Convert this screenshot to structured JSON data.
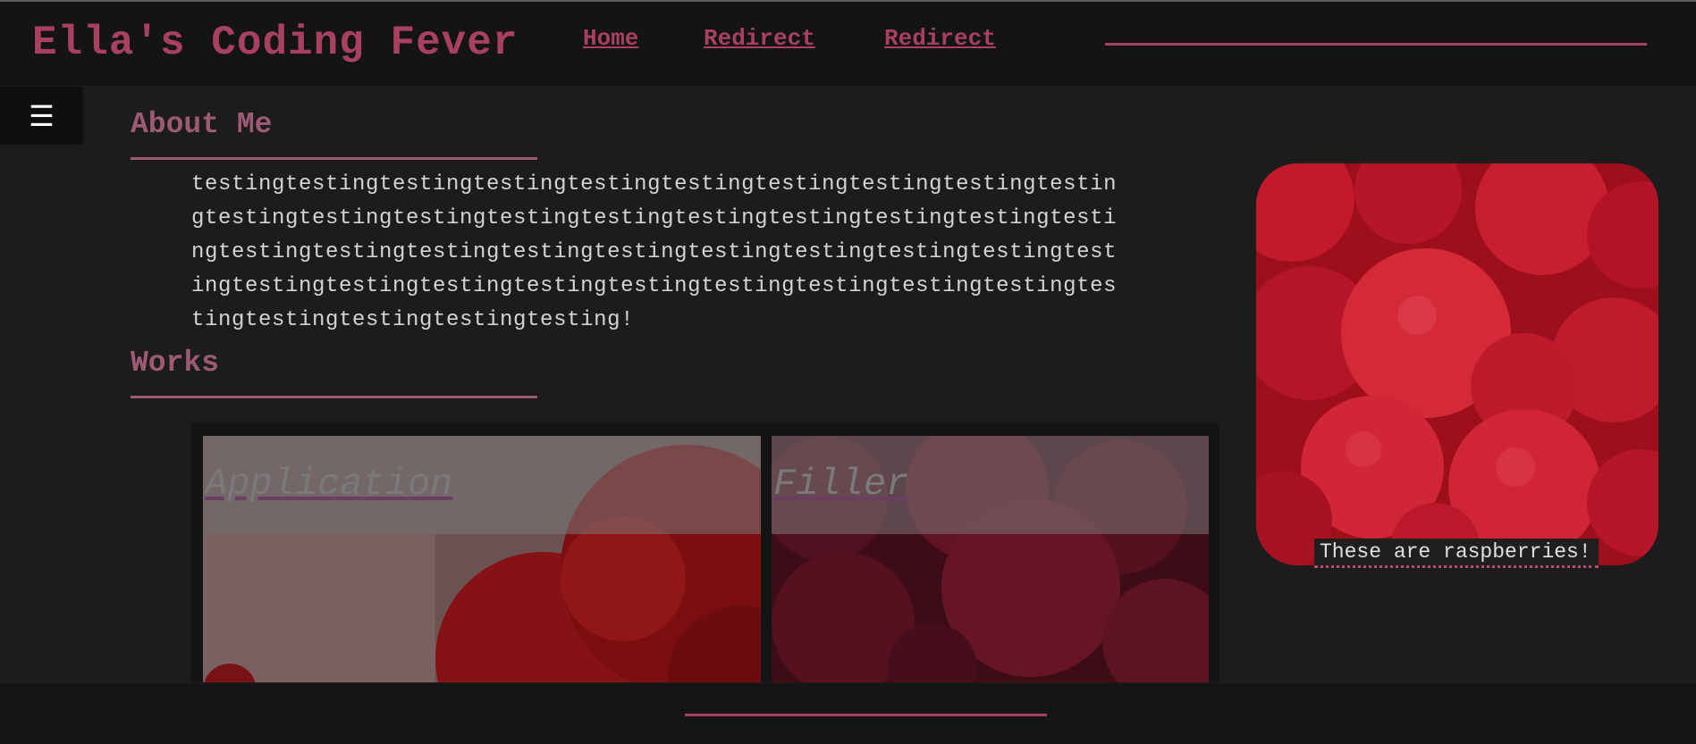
{
  "header": {
    "title": "Ella's Coding Fever",
    "nav": [
      {
        "label": "Home"
      },
      {
        "label": "Redirect"
      },
      {
        "label": "Redirect"
      }
    ]
  },
  "menu": {
    "icon": "hamburger-menu-icon",
    "glyph": "☰"
  },
  "about": {
    "heading": "About Me",
    "text": "testingtestingtestingtestingtestingtestingtestingtestingtestingtestingtestingtestingtestingtestingtestingtestingtestingtestingtestingtestingtestingtestingtestingtestingtestingtestingtestingtestingtestingtestingtestingtestingtestingtestingtestingtestingtestingtestingtestingtestingtestingtestingtestingtesting!"
  },
  "works": {
    "heading": "Works",
    "cards": [
      {
        "label": "Application"
      },
      {
        "label": "Filler"
      }
    ]
  },
  "photo": {
    "caption": "These are raspberries!"
  },
  "colors": {
    "accent": "#a8415f",
    "heading": "#9c5a74",
    "background": "#1c1c1c",
    "header_bg": "#141414"
  }
}
